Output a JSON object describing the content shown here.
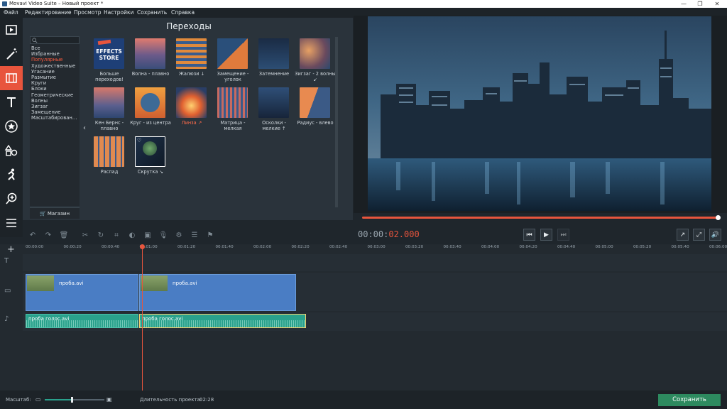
{
  "window": {
    "title": "Movavi Video Suite – Новый проект *",
    "controls": [
      "—",
      "❐",
      "✕"
    ]
  },
  "menu": [
    "Файл",
    "Редактирование",
    "Просмотр",
    "Настройки",
    "Сохранить",
    "Справка"
  ],
  "sidebar_tools": [
    "media-import",
    "filters",
    "transitions",
    "titles",
    "stickers",
    "callouts",
    "animation",
    "zoom",
    "more"
  ],
  "transitions": {
    "title": "Переходы",
    "categories": [
      "Все",
      "Избранные",
      "Популярные",
      "Художественные",
      "Угасание",
      "Размытие",
      "Круги",
      "Блоки",
      "Геометрические",
      "Волны",
      "Зигзаг",
      "Замещение",
      "Масштабирован…"
    ],
    "selected_category": "Популярные",
    "shop_label": "Магазин",
    "store_thumb_text": [
      "EFFECTS",
      "STORE"
    ],
    "items": [
      {
        "label": "Больше переходов!",
        "highlight": false
      },
      {
        "label": "Волна - плавно",
        "highlight": false
      },
      {
        "label": "Жалюзи ↓",
        "highlight": false
      },
      {
        "label": "Замещение - уголок",
        "highlight": false
      },
      {
        "label": "Затемнение",
        "highlight": false
      },
      {
        "label": "Зигзаг - 2 волны ↙",
        "highlight": false
      },
      {
        "label": "Кен Бернс - плавно",
        "highlight": false
      },
      {
        "label": "Круг - из центра",
        "highlight": false
      },
      {
        "label": "Линза ↗",
        "highlight": true
      },
      {
        "label": "Матрица - мелкая",
        "highlight": false
      },
      {
        "label": "Осколки - мелкие ↑",
        "highlight": false
      },
      {
        "label": "Радиус - влево",
        "highlight": false
      },
      {
        "label": "Распад",
        "highlight": false
      },
      {
        "label": "Скрутка ↘",
        "highlight": false
      }
    ]
  },
  "player": {
    "timecode_gray": "00:00:",
    "timecode_red": "02.000",
    "progress_fraction": 1.0
  },
  "ruler_labels": [
    "00:00:00",
    "00:00:20",
    "00:00:40",
    "00:01:00",
    "00:01:20",
    "00:01:40",
    "00:02:00",
    "00:02:20",
    "00:02:40",
    "00:03:00",
    "00:03:20",
    "00:03:40",
    "00:04:00",
    "00:04:20",
    "00:04:40",
    "00:05:00",
    "00:05:20",
    "00:05:40",
    "00:06:00"
  ],
  "timeline": {
    "video_clips": [
      "проба.avi",
      "проба.avi"
    ],
    "audio_clips": [
      "проба голос.avi",
      "проба голос.avi"
    ]
  },
  "bottom": {
    "zoom_label": "Масштаб:",
    "zoom_fraction": 0.45,
    "duration_label": "Длительность проекта:",
    "duration_value": "02:28",
    "save_label": "Сохранить"
  },
  "colors": {
    "accent": "#e8553d",
    "video_clip": "#4a7dc4",
    "audio_clip": "#2aa18c",
    "save": "#2d8a5f"
  }
}
